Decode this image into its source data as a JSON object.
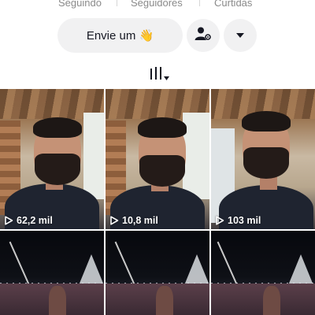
{
  "profile_stats": {
    "following_label": "Seguindo",
    "followers_label": "Seguidores",
    "likes_label": "Curtidas"
  },
  "actions": {
    "message_button_label": "Envie um 👋",
    "message_icon": "wave-emoji",
    "user_settings_icon": "user-gear-icon",
    "more_icon": "caret-down-icon"
  },
  "tabs": {
    "videos_tab_icon": "grid-lines-icon",
    "dropdown_icon": "small-caret-icon"
  },
  "videos": [
    {
      "views": "62,2 mil",
      "thumbnail": "selfie-wood-room"
    },
    {
      "views": "10,8 mil",
      "thumbnail": "selfie-wood-room"
    },
    {
      "views": "103 mil",
      "thumbnail": "selfie-window"
    },
    {
      "views": "",
      "thumbnail": "night-stage"
    },
    {
      "views": "",
      "thumbnail": "night-stage"
    },
    {
      "views": "",
      "thumbnail": "night-stage"
    }
  ],
  "colors": {
    "button_bg": "#f1f1f2",
    "text_primary": "#161823",
    "text_secondary": "#8a8a8a"
  }
}
